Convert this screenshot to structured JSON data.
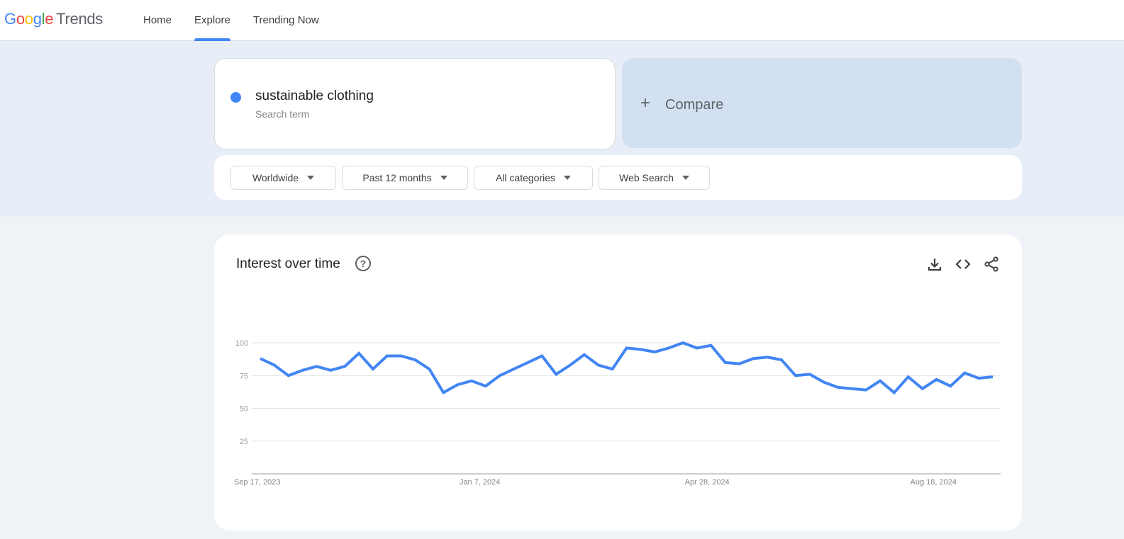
{
  "app": {
    "logo_letters": [
      "G",
      "o",
      "o",
      "g",
      "l",
      "e"
    ],
    "logo_product": "Trends"
  },
  "nav": {
    "items": [
      {
        "label": "Home",
        "active": false
      },
      {
        "label": "Explore",
        "active": true
      },
      {
        "label": "Trending Now",
        "active": false
      }
    ]
  },
  "search": {
    "term": "sustainable clothing",
    "term_type": "Search term",
    "term_color": "#4285f4",
    "compare_icon": "plus-icon",
    "compare_label": "Compare"
  },
  "filters": [
    {
      "label": "Worldwide",
      "icon": "caret-down-icon"
    },
    {
      "label": "Past 12 months",
      "icon": "caret-down-icon"
    },
    {
      "label": "All categories",
      "icon": "caret-down-icon"
    },
    {
      "label": "Web Search",
      "icon": "caret-down-icon"
    }
  ],
  "interest_card": {
    "title": "Interest over time",
    "help_icon": "help-circle-icon",
    "help_glyph": "?",
    "actions": [
      "download-icon",
      "embed-code-icon",
      "share-icon"
    ]
  },
  "chart_data": {
    "type": "line",
    "title": "Interest over time",
    "xlabel": "",
    "ylabel": "",
    "ylim": [
      0,
      100
    ],
    "yticks": [
      25,
      50,
      75,
      100
    ],
    "ytick_labels": [
      "25",
      "50",
      "75",
      "100"
    ],
    "xtick_labels": [
      {
        "label": "Sep 17, 2023",
        "index": 0
      },
      {
        "label": "Jan 7, 2024",
        "index": 16
      },
      {
        "label": "Apr 28, 2024",
        "index": 32
      },
      {
        "label": "Aug 18, 2024",
        "index": 48
      }
    ],
    "grid": true,
    "series": [
      {
        "name": "sustainable clothing",
        "color": "#4285f4",
        "values": [
          88,
          83,
          75,
          79,
          82,
          79,
          82,
          92,
          80,
          90,
          90,
          87,
          80,
          62,
          68,
          71,
          67,
          75,
          80,
          85,
          90,
          76,
          83,
          91,
          83,
          80,
          96,
          95,
          93,
          96,
          100,
          96,
          98,
          85,
          84,
          88,
          89,
          87,
          75,
          76,
          70,
          66,
          65,
          64,
          71,
          62,
          74,
          65,
          72,
          67,
          77,
          73,
          74
        ]
      }
    ]
  }
}
